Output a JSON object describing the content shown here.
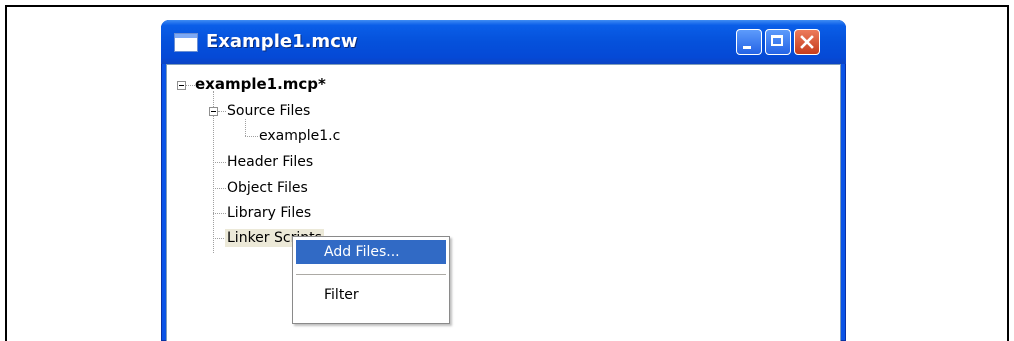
{
  "window": {
    "title": "Example1.mcw",
    "controls": {
      "minimize": "minimize",
      "maximize": "maximize",
      "close": "close"
    }
  },
  "tree": {
    "root": "example1.mcp*",
    "folders": [
      {
        "label": "Source Files",
        "expanded": true,
        "children": [
          "example1.c"
        ]
      },
      {
        "label": "Header Files"
      },
      {
        "label": "Object Files"
      },
      {
        "label": "Library Files"
      },
      {
        "label": "Linker Scripts"
      }
    ]
  },
  "context_menu": {
    "items": [
      {
        "label": "Add Files...",
        "highlighted": true
      },
      {
        "label": "Filter",
        "highlighted": false
      }
    ]
  },
  "colors": {
    "titlebar": "#0551db",
    "menu_highlight": "#316ac5",
    "selected_node_bg": "#ece9d8"
  }
}
